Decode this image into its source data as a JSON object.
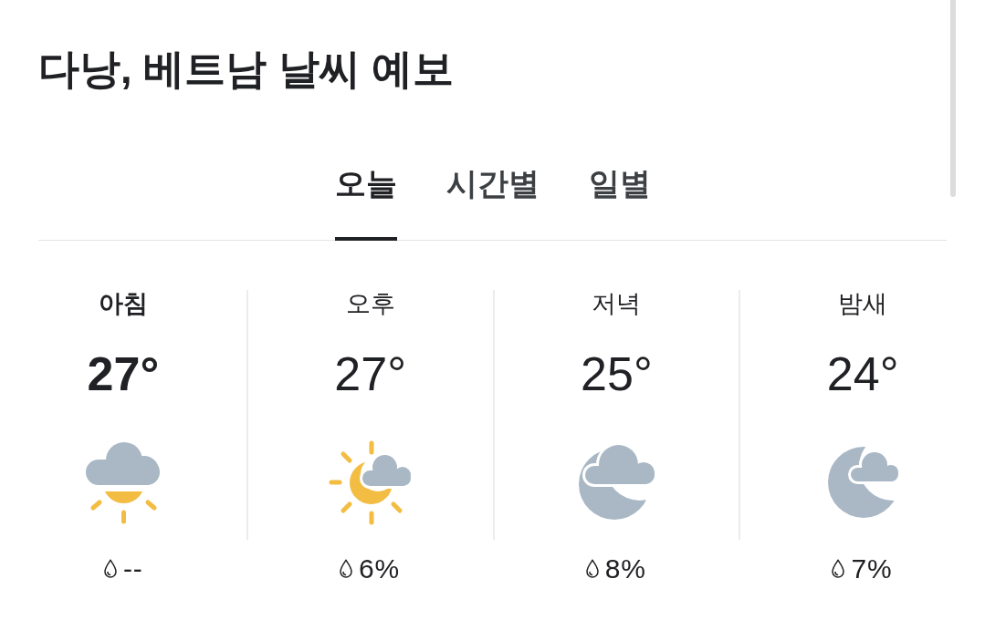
{
  "title": "다낭, 베트남 날씨 예보",
  "tabs": [
    {
      "label": "오늘",
      "selected": true
    },
    {
      "label": "시간별",
      "selected": false
    },
    {
      "label": "일별",
      "selected": false
    }
  ],
  "periods": [
    {
      "label": "아침",
      "temperature": "27°",
      "kind": "sunrise",
      "precipitation": "--",
      "selected": true
    },
    {
      "label": "오후",
      "temperature": "27°",
      "kind": "twilight",
      "precipitation": "6%",
      "selected": false
    },
    {
      "label": "저녁",
      "temperature": "25°",
      "kind": "cloudynight",
      "precipitation": "8%",
      "selected": false
    },
    {
      "label": "밤새",
      "temperature": "24°",
      "kind": "night",
      "precipitation": "7%",
      "selected": false
    }
  ]
}
